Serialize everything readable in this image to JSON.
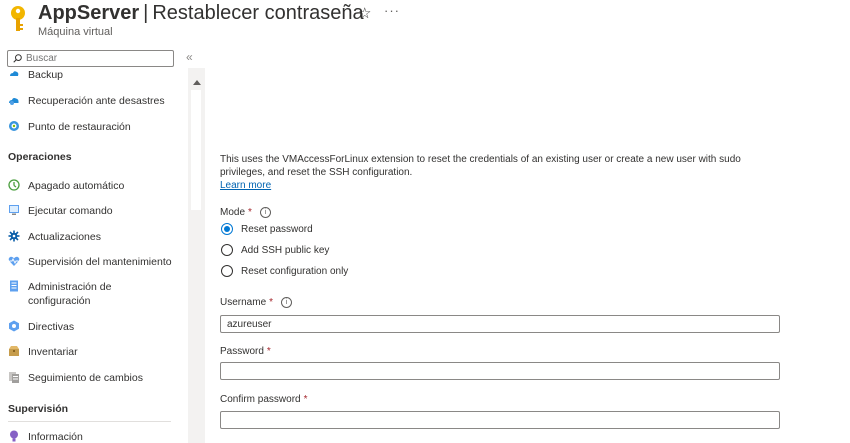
{
  "header": {
    "title": "AppServer",
    "separator": "|",
    "page": "Restablecer contraseña",
    "subtitle": "Máquina virtual",
    "star_glyph": "☆",
    "more_glyph": "···"
  },
  "sidebar": {
    "search_placeholder": "Buscar",
    "collapse_glyph": "«",
    "items_top": [
      {
        "label": "Backup",
        "icon": "backup-icon"
      },
      {
        "label": "Recuperación ante desastres",
        "icon": "disaster-recovery-icon"
      },
      {
        "label": "Punto de restauración",
        "icon": "restore-point-icon"
      }
    ],
    "section_operations": "Operaciones",
    "items_operations": [
      {
        "label": "Apagado automático",
        "icon": "auto-shutdown-icon"
      },
      {
        "label": "Ejecutar comando",
        "icon": "run-command-icon"
      },
      {
        "label": "Actualizaciones",
        "icon": "updates-icon"
      },
      {
        "label": "Supervisión del mantenimiento",
        "icon": "maintenance-icon"
      },
      {
        "label": "Administración de configuración",
        "icon": "configuration-icon"
      },
      {
        "label": "Directivas",
        "icon": "policies-icon"
      },
      {
        "label": "Inventariar",
        "icon": "inventory-icon"
      },
      {
        "label": "Seguimiento de cambios",
        "icon": "change-tracking-icon"
      }
    ],
    "section_monitoring": "Supervisión",
    "items_monitoring": [
      {
        "label": "Información",
        "icon": "insights-icon"
      }
    ]
  },
  "form": {
    "description": "This uses the VMAccessForLinux extension to reset the credentials of an existing user or create a new user with sudo privileges, and reset the SSH configuration.",
    "learn_more": "Learn more",
    "mode_label": "Mode",
    "required_mark": "*",
    "info_glyph": "i",
    "modes": [
      {
        "label": "Reset password",
        "selected": true
      },
      {
        "label": "Add SSH public key",
        "selected": false
      },
      {
        "label": "Reset configuration only",
        "selected": false
      }
    ],
    "username_label": "Username",
    "username_value": "azureuser",
    "password_label": "Password",
    "password_value": "",
    "confirm_label": "Confirm password",
    "confirm_value": ""
  },
  "colors": {
    "accent": "#0078d4",
    "required": "#a4262c",
    "link": "#0063b1"
  }
}
